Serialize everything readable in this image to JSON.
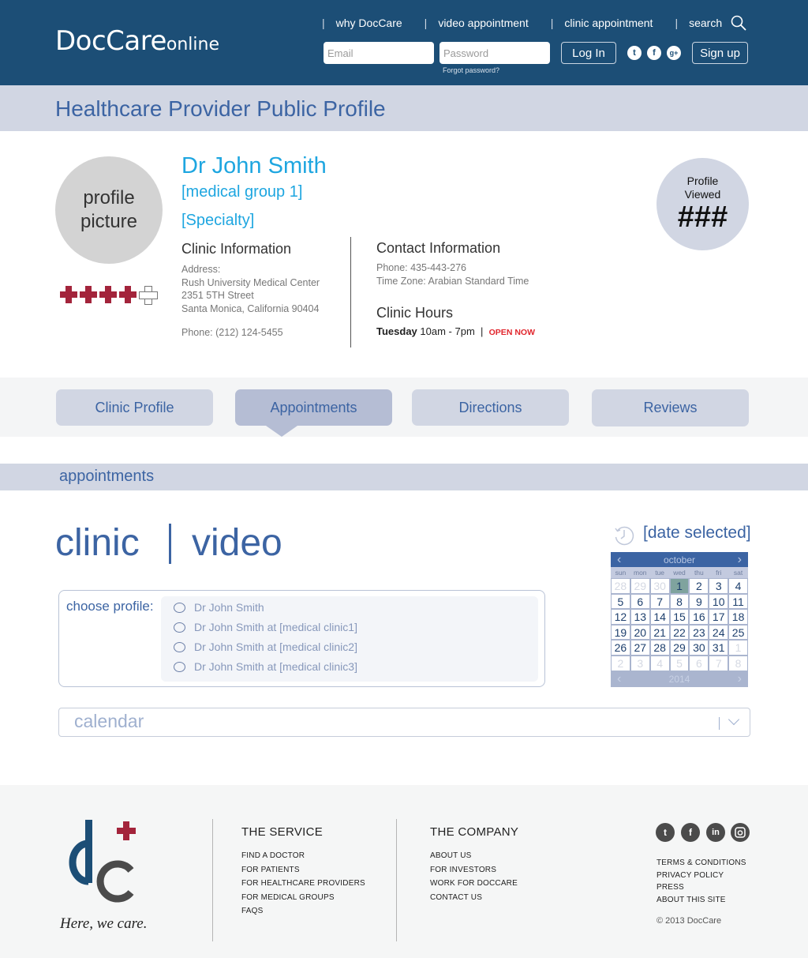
{
  "header": {
    "logo_main": "DocCare",
    "logo_sub": "online",
    "nav": [
      {
        "label": "why DocCare"
      },
      {
        "label": "video appointment"
      },
      {
        "label": "clinic appointment"
      },
      {
        "label": "search"
      }
    ],
    "email_placeholder": "Email",
    "password_placeholder": "Password",
    "forgot_password": "Forgot password?",
    "login_label": "Log In",
    "signup_label": "Sign up",
    "social": [
      {
        "icon": "twitter-icon",
        "glyph": "t"
      },
      {
        "icon": "facebook-icon",
        "glyph": "f"
      },
      {
        "icon": "google-plus-icon",
        "glyph": "g+"
      }
    ]
  },
  "page_title": "Healthcare Provider Public Profile",
  "profile": {
    "picture_label_1": "profile",
    "picture_label_2": "picture",
    "rating": {
      "value": 4,
      "max": 5
    },
    "name": "Dr John Smith",
    "group": "[medical group 1]",
    "specialty": "[Specialty]",
    "clinic_info": {
      "heading": "Clinic Information",
      "address_label": "Address:",
      "address_line1": "Rush University Medical Center",
      "address_line2": "2351 5TH Street",
      "address_line3": "Santa Monica, California 90404",
      "phone": "Phone: (212) 124-5455"
    },
    "contact_info": {
      "heading": "Contact Information",
      "phone": "Phone: 435-443-276",
      "timezone": "Time Zone: Arabian Standard Time"
    },
    "clinic_hours": {
      "heading": "Clinic Hours",
      "day": "Tuesday",
      "hours": "10am - 7pm",
      "separator": "|",
      "status": "OPEN NOW"
    },
    "viewed": {
      "label_1": "Profile",
      "label_2": "Viewed",
      "count": "###"
    }
  },
  "tabs": [
    {
      "label": "Clinic Profile",
      "active": false
    },
    {
      "label": "Appointments",
      "active": true
    },
    {
      "label": "Directions",
      "active": false
    },
    {
      "label": "Reviews",
      "active": false
    }
  ],
  "appointments": {
    "section_title": "appointments",
    "mode_clinic": "clinic",
    "mode_video": "video",
    "choose_label": "choose profile:",
    "options": [
      "Dr John Smith",
      "Dr John Smith at [medical clinic1]",
      "Dr John Smith at [medical clinic2]",
      "Dr John Smith at [medical clinic3]"
    ],
    "calendar_placeholder": "calendar",
    "date_selected": "[date selected]",
    "calendar": {
      "month": "october",
      "year": "2014",
      "prev": "‹",
      "next": "›",
      "weekdays": [
        "sun",
        "mon",
        "tue",
        "wed",
        "thu",
        "fri",
        "sat"
      ],
      "selected_day": 1,
      "days": [
        {
          "d": "28",
          "m": true
        },
        {
          "d": "29",
          "m": true
        },
        {
          "d": "30",
          "m": true
        },
        {
          "d": "1",
          "s": true
        },
        {
          "d": "2"
        },
        {
          "d": "3"
        },
        {
          "d": "4"
        },
        {
          "d": "5"
        },
        {
          "d": "6"
        },
        {
          "d": "7"
        },
        {
          "d": "8"
        },
        {
          "d": "9"
        },
        {
          "d": "10"
        },
        {
          "d": "11"
        },
        {
          "d": "12"
        },
        {
          "d": "13"
        },
        {
          "d": "14"
        },
        {
          "d": "15"
        },
        {
          "d": "16"
        },
        {
          "d": "17"
        },
        {
          "d": "18"
        },
        {
          "d": "19"
        },
        {
          "d": "20"
        },
        {
          "d": "21"
        },
        {
          "d": "22"
        },
        {
          "d": "23"
        },
        {
          "d": "24"
        },
        {
          "d": "25"
        },
        {
          "d": "26"
        },
        {
          "d": "27"
        },
        {
          "d": "28"
        },
        {
          "d": "29"
        },
        {
          "d": "30"
        },
        {
          "d": "31"
        },
        {
          "d": "1",
          "m": true
        },
        {
          "d": "2",
          "m": true
        },
        {
          "d": "3",
          "m": true
        },
        {
          "d": "4",
          "m": true
        },
        {
          "d": "5",
          "m": true
        },
        {
          "d": "6",
          "m": true
        },
        {
          "d": "7",
          "m": true
        },
        {
          "d": "8",
          "m": true
        }
      ]
    }
  },
  "footer": {
    "tagline": "Here, we care.",
    "service_heading": "THE SERVICE",
    "service_links": [
      "FIND A DOCTOR",
      "FOR PATIENTS",
      "FOR HEALTHCARE PROVIDERS",
      "FOR MEDICAL GROUPS",
      "FAQS"
    ],
    "company_heading": "THE COMPANY",
    "company_links": [
      "ABOUT US",
      "FOR INVESTORS",
      "WORK FOR DOCCARE",
      "CONTACT US"
    ],
    "legal_links": [
      "TERMS & CONDITIONS",
      "PRIVACY POLICY",
      "PRESS",
      "ABOUT THIS SITE"
    ],
    "social": [
      {
        "icon": "twitter-icon",
        "glyph": "t"
      },
      {
        "icon": "facebook-icon",
        "glyph": "f"
      },
      {
        "icon": "linkedin-icon",
        "glyph": "in"
      },
      {
        "icon": "instagram-icon",
        "glyph": "◙"
      }
    ],
    "copyright": "© 2013 DocCare"
  },
  "colors": {
    "brand_dark_blue": "#1c4e76",
    "accent_blue": "#3c64a3",
    "name_cyan": "#1ea6e0",
    "rating_red": "#a3243b",
    "open_red": "#e1262d",
    "band_grey": "#d1d6e3"
  }
}
